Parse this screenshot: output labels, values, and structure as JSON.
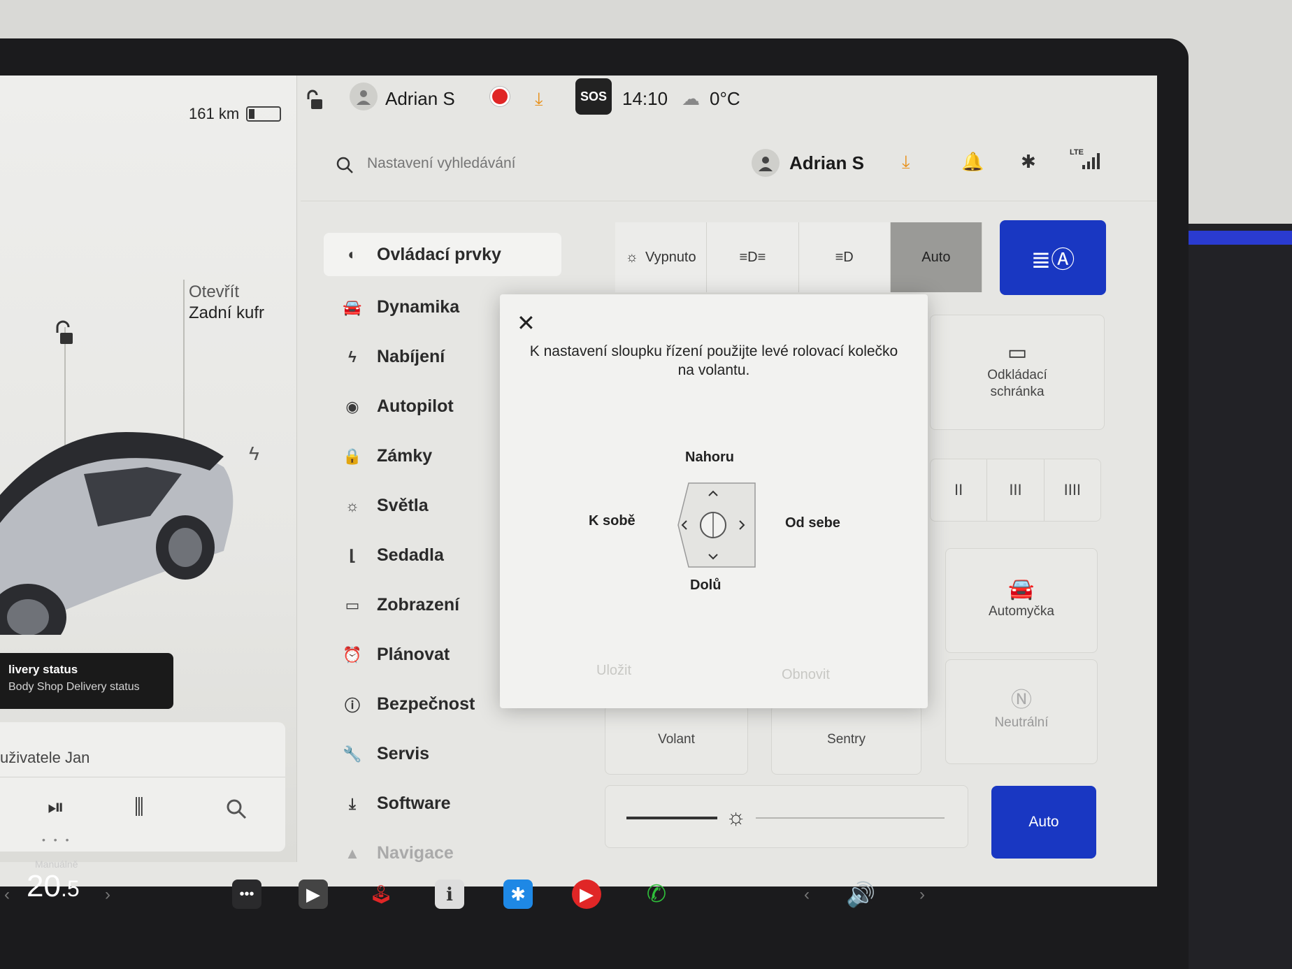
{
  "left_panel": {
    "range": "161 km",
    "trunk_open": "Otevřít",
    "trunk_name": "Zadní kufr",
    "delivery_title": "livery status",
    "delivery_sub": "Body Shop Delivery status",
    "media_user": "uživatele Jan"
  },
  "status_bar": {
    "user": "Adrian S",
    "sos": "SOS",
    "time": "14:10",
    "temperature": "0°C"
  },
  "settings_header": {
    "search_placeholder": "Nastavení vyhledávání",
    "profile_name": "Adrian S",
    "network": "LTE"
  },
  "menu": {
    "items": [
      {
        "label": "Ovládací prvky",
        "icon": "toggle-icon"
      },
      {
        "label": "Dynamika",
        "icon": "car-icon"
      },
      {
        "label": "Nabíjení",
        "icon": "bolt-icon"
      },
      {
        "label": "Autopilot",
        "icon": "steering-wheel-icon"
      },
      {
        "label": "Zámky",
        "icon": "lock-icon"
      },
      {
        "label": "Světla",
        "icon": "light-icon"
      },
      {
        "label": "Sedadla",
        "icon": "seat-icon"
      },
      {
        "label": "Zobrazení",
        "icon": "display-icon"
      },
      {
        "label": "Plánovat",
        "icon": "alarm-icon"
      },
      {
        "label": "Bezpečnost",
        "icon": "alert-icon"
      },
      {
        "label": "Servis",
        "icon": "wrench-icon"
      },
      {
        "label": "Software",
        "icon": "download-icon"
      },
      {
        "label": "Navigace",
        "icon": "navigation-icon"
      }
    ]
  },
  "controls": {
    "lights_off": "Vypnuto",
    "lights_auto": "Auto",
    "glovebox_line1": "Odkládací",
    "glovebox_line2": "schránka",
    "wiper_2": "II",
    "wiper_3": "III",
    "wiper_4": "IIII",
    "carwash": "Automyčka",
    "steering": "Volant",
    "sentry": "Sentry",
    "neutral": "Neutrální",
    "brightness_auto": "Auto"
  },
  "modal": {
    "message": "K nastavení sloupku řízení použijte levé rolovací kolečko na volantu.",
    "up": "Nahoru",
    "down": "Dolů",
    "toward": "K sobě",
    "away": "Od sebe",
    "save": "Uložit",
    "restore": "Obnovit"
  },
  "dock": {
    "climate_mode": "Manuálně",
    "temp_whole": "20",
    "temp_decimal": ".5"
  },
  "colors": {
    "accent_blue": "#1937c2",
    "record_red": "#e02626",
    "download_orange": "#e8901a",
    "phone_green": "#2fbf3a",
    "bluetooth_blue": "#1e88e5",
    "youtube_red": "#e02626"
  }
}
